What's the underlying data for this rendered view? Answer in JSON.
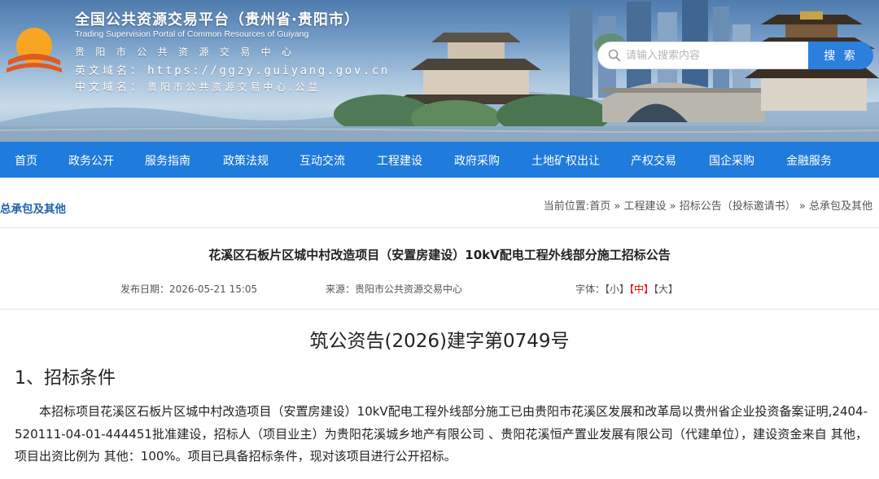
{
  "header": {
    "site_title": "全国公共资源交易平台（贵州省·贵阳市）",
    "site_subtitle": "Trading Supervision Portal of Common Resources of Guiyang",
    "org_name": "贵阳市公共资源交易中心",
    "en_domain_label": "英文域名：",
    "en_domain_value": "https://ggzy.guiyang.gov.cn",
    "cn_domain_label": "中文域名：",
    "cn_domain_value": "贵阳市公共资源交易中心.公益",
    "search_placeholder": "请输入搜索内容",
    "search_button": "搜 索"
  },
  "nav": {
    "items": [
      "首页",
      "政务公开",
      "服务指南",
      "政策法规",
      "互动交流",
      "工程建设",
      "政府采购",
      "土地矿权出让",
      "产权交易",
      "国企采购",
      "金融服务"
    ]
  },
  "section": {
    "title": "总承包及其他"
  },
  "breadcrumb": {
    "prefix": "当前位置:",
    "items": [
      "首页",
      "工程建设",
      "招标公告（投标邀请书）",
      "总承包及其他"
    ],
    "separator": "»"
  },
  "article": {
    "title": "花溪区石板片区城中村改造项目（安置房建设）10kV配电工程外线部分施工招标公告",
    "publish_label": "发布日期：",
    "publish_date": "2026-05-21 15:05",
    "source_label": "来源：",
    "source_value": "贵阳市公共资源交易中心",
    "font_label": "字体：",
    "font_small": "【小】",
    "font_medium": "【中】",
    "font_large": "【大】",
    "doc_number": "筑公资告(2026)建字第0749号",
    "section1_heading": "1、招标条件",
    "section1_body": "本招标项目花溪区石板片区城中村改造项目（安置房建设）10kV配电工程外线部分施工已由贵阳市花溪区发展和改革局以贵州省企业投资备案证明,2404-520111-04-01-444451批准建设，招标人（项目业主）为贵阳花溪城乡地产有限公司 、贵阳花溪恒产置业发展有限公司（代建单位），建设资金来自 其他， 项目出资比例为 其他：100%。项目已具备招标条件，现对该项目进行公开招标。"
  },
  "colors": {
    "nav_bg": "#1f7bdc",
    "search_button_bg": "#2c7fdc",
    "section_title": "#1e5fae",
    "active_font_size": "#ee0000"
  }
}
